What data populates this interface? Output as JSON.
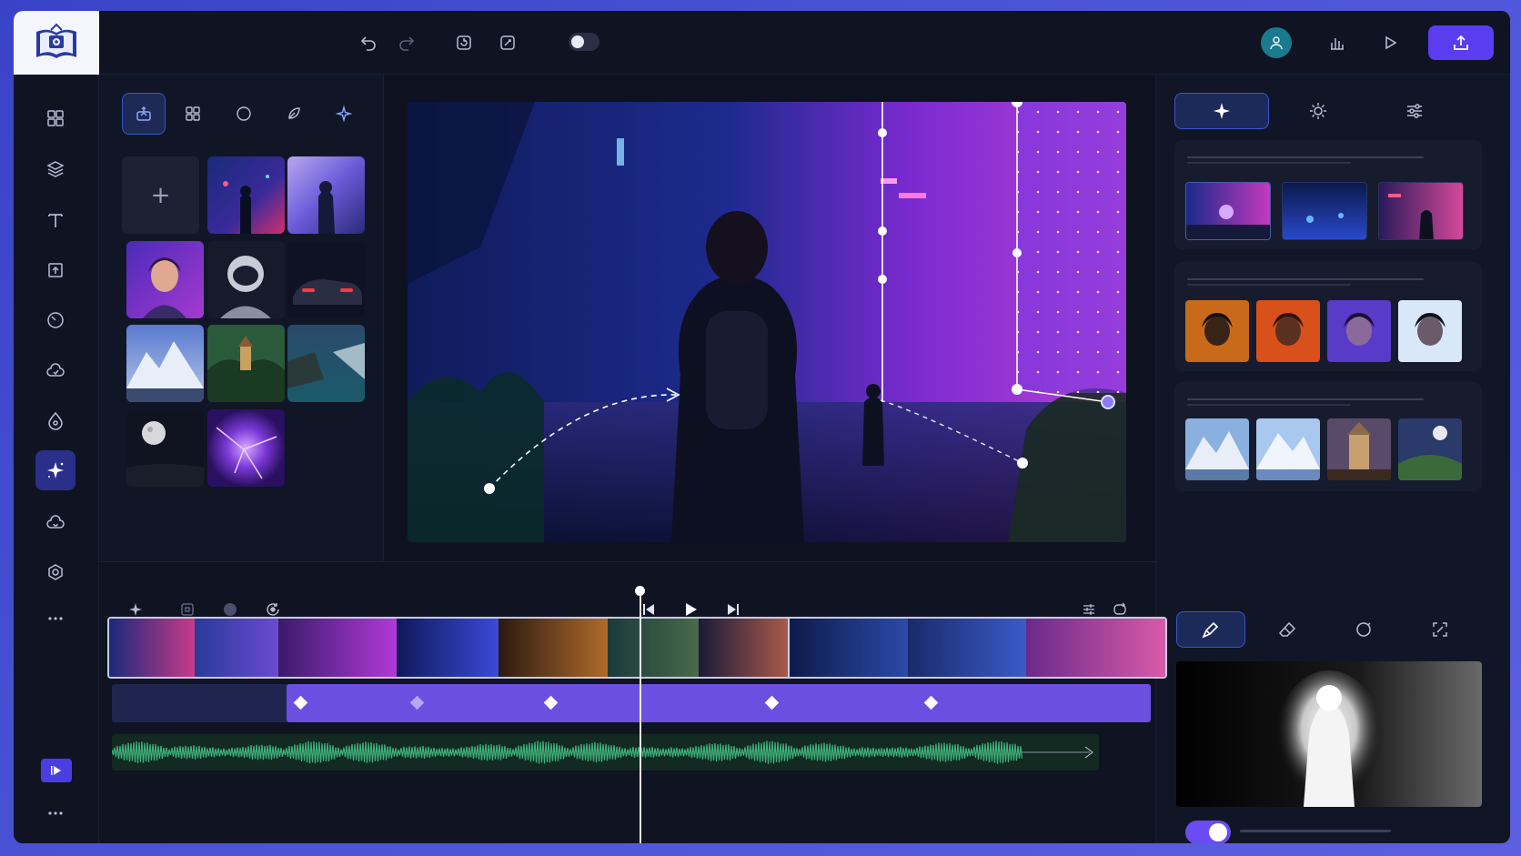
{
  "app": {
    "name": "Video Editor"
  },
  "topbar": {
    "icons": [
      "undo-icon",
      "redo-icon",
      "frame-capture-icon",
      "frame-edit-icon",
      "theme-toggle",
      "collaborators-icon",
      "analytics-icon",
      "play-icon",
      "export-icon"
    ]
  },
  "rail": {
    "items": [
      "grid-icon",
      "layers-icon",
      "text-icon",
      "crop-icon",
      "speed-icon",
      "cloud-icon",
      "drop-icon",
      "magic-sparkle-icon",
      "cloud-sync-icon",
      "settings-icon",
      "more-icon",
      "play-icon",
      "more-icon"
    ],
    "active": "magic-sparkle-icon"
  },
  "media": {
    "tabs": [
      "image-upload-icon",
      "grid-icon",
      "circle-icon",
      "leaf-icon",
      "sparkle-icon"
    ],
    "active_tab": 0,
    "add_label": "+"
  },
  "right_panel": {
    "tabs": [
      "sparkle-icon",
      "sun-icon",
      "sliders-icon"
    ],
    "active_tab": 0,
    "tools": [
      "brush-icon",
      "eraser-icon",
      "lasso-icon",
      "crop-frame-icon"
    ],
    "active_tool": 0,
    "add_swatch_label": "+",
    "toggle_on": true
  },
  "timeline": {
    "left_tools": [
      "sparkle-icon",
      "screen-icon",
      "record-icon",
      "refresh-icon"
    ],
    "transport": [
      "skip-back-icon",
      "play-icon",
      "skip-forward-icon"
    ],
    "right_tools": [
      "filter-icon",
      "loop-icon"
    ],
    "playhead_fraction": 0.47,
    "colors": {
      "keyframe_bar": "#6b4fe0",
      "audio_wave": "#3fb27a",
      "accent": "#5b3df0"
    }
  }
}
